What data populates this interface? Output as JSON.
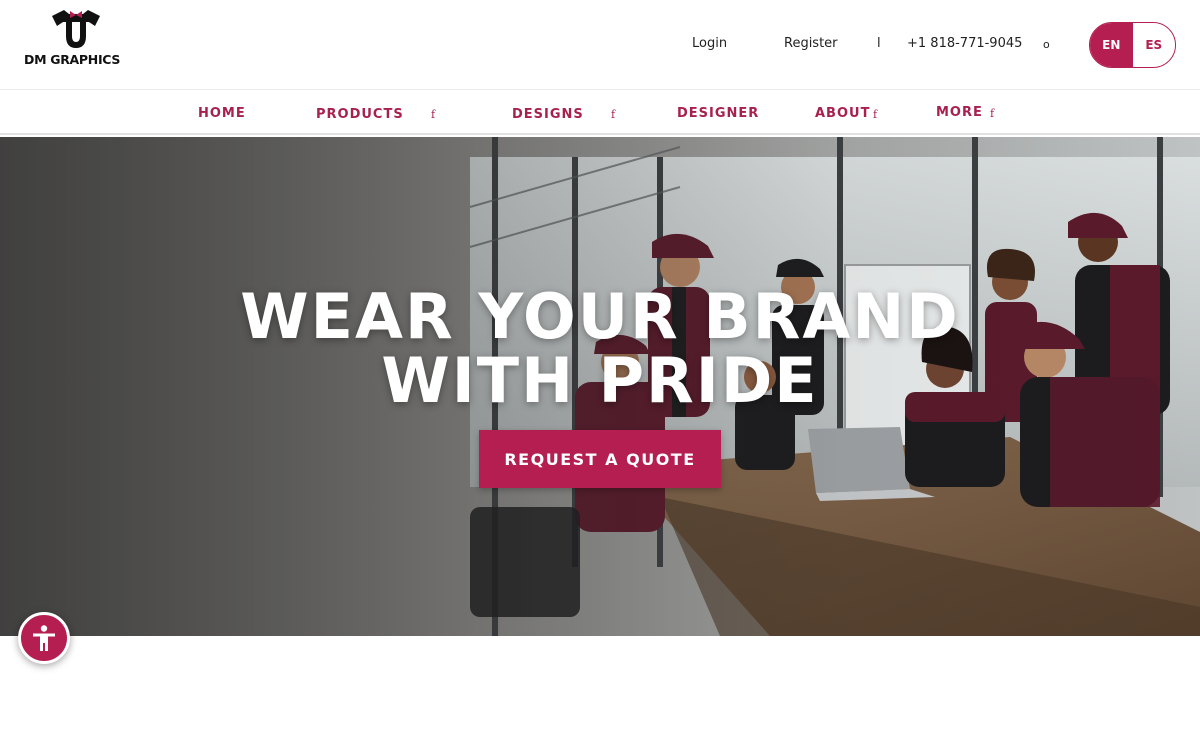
{
  "brand": {
    "name": "DM GRAPHICS",
    "accent": "#b51e50"
  },
  "topbar": {
    "login": "Login",
    "register": "Register",
    "separator": "l",
    "phone": "+1 818-771-9045",
    "phone_suffix": "o",
    "languages": [
      {
        "label": "EN",
        "active": true
      },
      {
        "label": "ES",
        "active": false
      }
    ]
  },
  "nav": {
    "items": [
      {
        "label": "HOME",
        "has_caret": false
      },
      {
        "label": "PRODUCTS",
        "has_caret": true
      },
      {
        "label": "DESIGNS",
        "has_caret": true
      },
      {
        "label": "DESIGNER",
        "has_caret": false
      },
      {
        "label": "ABOUT",
        "has_caret": true
      },
      {
        "label": "MORE",
        "has_caret": true
      }
    ],
    "caret_glyph": "f"
  },
  "hero": {
    "title_line1": "WEAR YOUR BRAND",
    "title_line2": "WITH PRIDE",
    "cta": "REQUEST A QUOTE",
    "image": "team-in-uniforms-at-conference-table"
  },
  "icons": {
    "accessibility": "accessibility-icon",
    "logo": "shirt-logo-icon"
  }
}
